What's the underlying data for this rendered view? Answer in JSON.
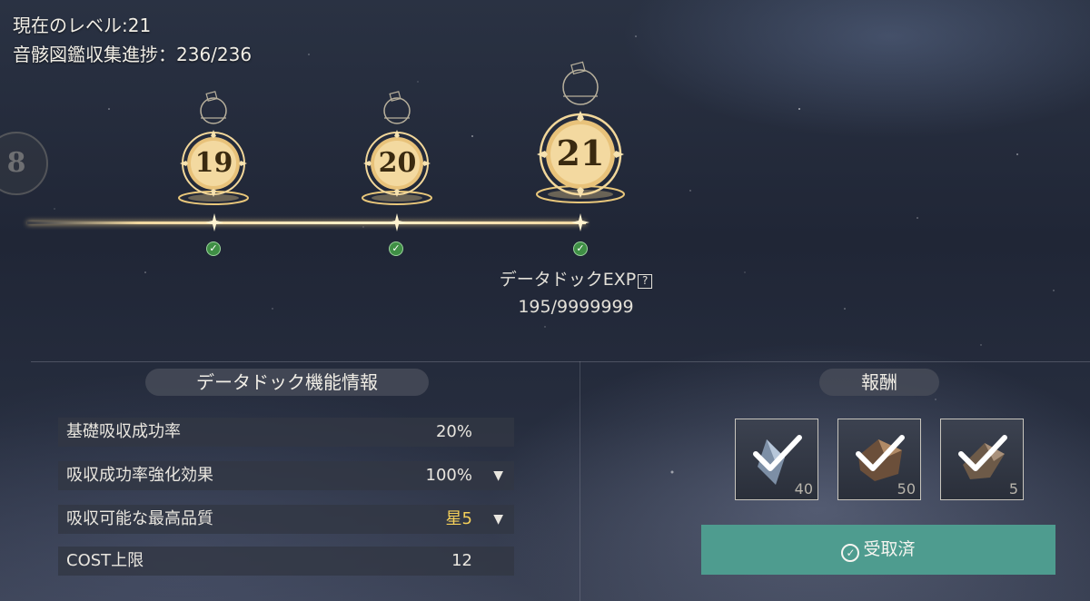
{
  "header": {
    "level_label": "現在のレベル:21",
    "collection_label": "音骸図鑑収集進捗：236/236"
  },
  "timeline": {
    "partial_prev_level": "8",
    "levels": [
      "19",
      "20",
      "21"
    ],
    "completed": [
      true,
      true,
      true
    ]
  },
  "exp": {
    "label": "データドックEXP",
    "help_icon": "?",
    "value": "195/9999999"
  },
  "info_panel": {
    "title": "データドック機能情報",
    "rows": [
      {
        "label": "基礎吸収成功率",
        "value": "20%"
      },
      {
        "label": "吸収成功率強化効果",
        "value": "100%"
      },
      {
        "label": "吸収可能な最高品質",
        "value": "星5"
      },
      {
        "label": "COST上限",
        "value": "12"
      }
    ]
  },
  "rewards": {
    "title": "報酬",
    "items": [
      {
        "icon": "star-shard-icon",
        "qty": "40"
      },
      {
        "icon": "ore-chunk-icon",
        "qty": "50"
      },
      {
        "icon": "ore-chunk-icon",
        "qty": "5"
      }
    ],
    "claim_label": "受取済"
  },
  "colors": {
    "accent_teal": "#4e9c8f",
    "gold": "#f4cf5a",
    "check_green": "#3f8f45"
  }
}
